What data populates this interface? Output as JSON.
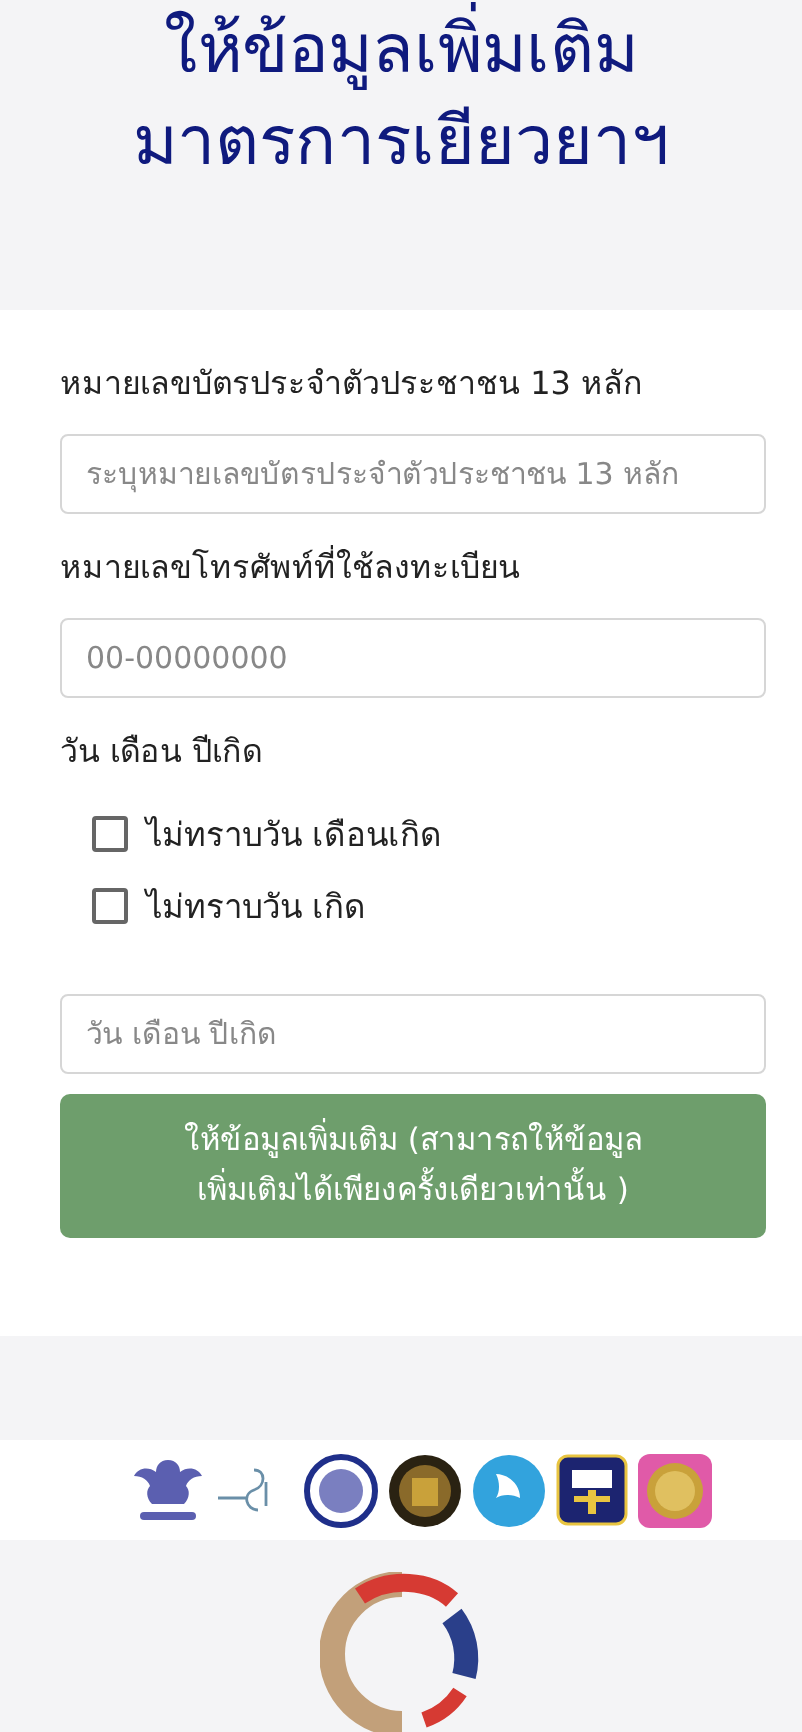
{
  "header": {
    "title_lines": [
      "ให้ข้อมูลเพิ่มเติม",
      "มาตรการเยียวยาฯ"
    ]
  },
  "form": {
    "fields": [
      {
        "label": "หมายเลขบัตรประจำตัวประชาชน 13 หลัก",
        "placeholder": "ระบุหมายเลขบัตรประจำตัวประชาชน 13 หลัก"
      },
      {
        "label": "หมายเลขโทรศัพท์ที่ใช้ลงทะเบียน",
        "placeholder": "00-00000000"
      }
    ],
    "birth_label": "วัน เดือน ปีเกิด",
    "checkboxes": [
      {
        "label": "ไม่ทราบวัน เดือนเกิด",
        "checked": false
      },
      {
        "label": "ไม่ทราบวัน เกิด",
        "checked": false
      }
    ],
    "birth_field": {
      "placeholder": "วัน เดือน ปีเกิด"
    },
    "submit": {
      "lines": [
        "ให้ข้อมูลเพิ่มเติม (สามารถให้ข้อมูล",
        "เพิ่มเติมได้เพียงครั้งเดียวเท่านั้น )"
      ]
    }
  }
}
